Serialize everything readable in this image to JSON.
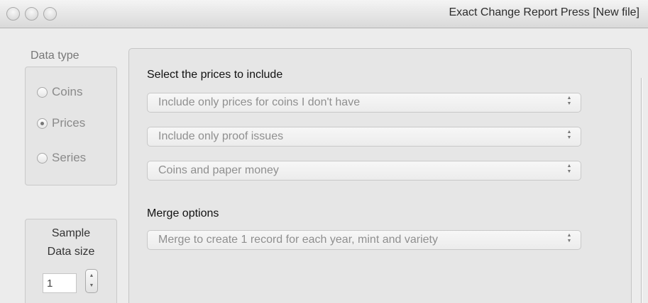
{
  "window": {
    "title": "Exact Change Report Press [New file]"
  },
  "data_type": {
    "label": "Data type",
    "options": [
      {
        "label": "Coins",
        "selected": false
      },
      {
        "label": "Prices",
        "selected": true
      },
      {
        "label": "Series",
        "selected": false
      }
    ]
  },
  "sample": {
    "title_line1": "Sample",
    "title_line2": "Data size",
    "value": "1"
  },
  "prices": {
    "title": "Select the prices to include",
    "selects": [
      "Include only prices for coins I don't have",
      "Include only proof issues",
      "Coins and paper money"
    ]
  },
  "merge": {
    "title": "Merge options",
    "select": "Merge to create 1 record for each year, mint and variety"
  },
  "icons": {
    "popup_arrows": "up-down-chevron-icon",
    "stepper_arrows": "stepper-icon",
    "window_buttons": "traffic-light-icon"
  }
}
